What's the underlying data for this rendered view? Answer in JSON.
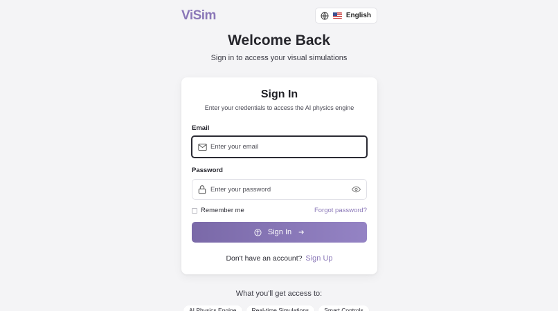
{
  "header": {
    "logo": "ViSim",
    "language": "English",
    "colors": {
      "brand": "#8b78b8",
      "background": "#f4f4f6"
    }
  },
  "hero": {
    "title": "Welcome Back",
    "subtitle": "Sign in to access your visual simulations"
  },
  "card": {
    "title": "Sign In",
    "subtitle": "Enter your credentials to access the AI physics engine",
    "email": {
      "label": "Email",
      "placeholder": "Enter your email",
      "value": "",
      "icon": "mail-icon"
    },
    "password": {
      "label": "Password",
      "placeholder": "Enter your password",
      "value": "",
      "icon": "lock-icon",
      "toggle_icon": "eye-icon"
    },
    "remember_label": "Remember me",
    "remember_checked": false,
    "forgot_label": "Forgot password?",
    "submit_label": "Sign In",
    "signup_prompt": "Don't have an account?",
    "signup_label": "Sign Up",
    "colors": {
      "button": "#8573b5"
    }
  },
  "access": {
    "title": "What you'll get access to:",
    "features": [
      "AI Physics Engine",
      "Real-time Simulations",
      "Smart Controls"
    ]
  }
}
